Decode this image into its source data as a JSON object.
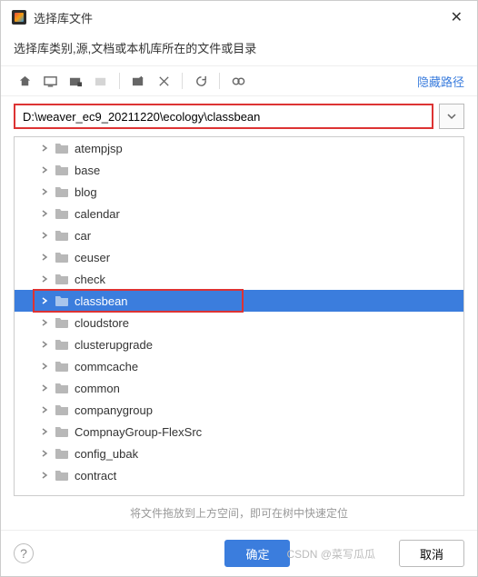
{
  "window": {
    "title": "选择库文件",
    "subheading": "选择库类别,源,文档或本机库所在的文件或目录"
  },
  "toolbar": {
    "hide_path_label": "隐藏路径"
  },
  "path": {
    "value": "D:\\weaver_ec9_20211220\\ecology\\classbean"
  },
  "tree": {
    "items": [
      {
        "label": "atempjsp",
        "selected": false
      },
      {
        "label": "base",
        "selected": false
      },
      {
        "label": "blog",
        "selected": false
      },
      {
        "label": "calendar",
        "selected": false
      },
      {
        "label": "car",
        "selected": false
      },
      {
        "label": "ceuser",
        "selected": false
      },
      {
        "label": "check",
        "selected": false
      },
      {
        "label": "classbean",
        "selected": true
      },
      {
        "label": "cloudstore",
        "selected": false
      },
      {
        "label": "clusterupgrade",
        "selected": false
      },
      {
        "label": "commcache",
        "selected": false
      },
      {
        "label": "common",
        "selected": false
      },
      {
        "label": "companygroup",
        "selected": false
      },
      {
        "label": "CompnayGroup-FlexSrc",
        "selected": false
      },
      {
        "label": "config_ubak",
        "selected": false
      },
      {
        "label": "contract",
        "selected": false
      }
    ]
  },
  "hint": "将文件拖放到上方空间，即可在树中快速定位",
  "footer": {
    "ok": "确定",
    "cancel": "取消"
  },
  "watermark": "CSDN @菜写瓜瓜"
}
